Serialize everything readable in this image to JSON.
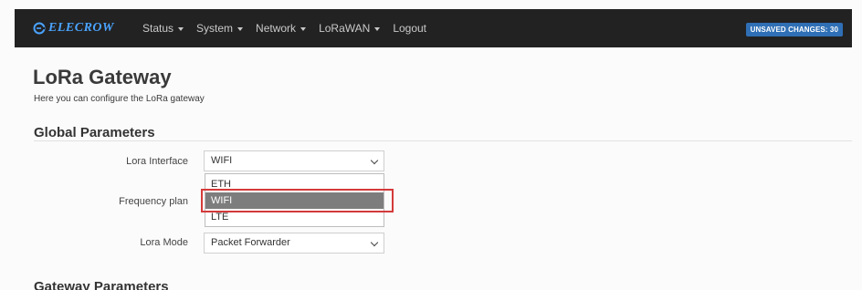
{
  "navbar": {
    "brand": "ELECROW",
    "menu": [
      {
        "label": "Status",
        "has_caret": true
      },
      {
        "label": "System",
        "has_caret": true
      },
      {
        "label": "Network",
        "has_caret": true
      },
      {
        "label": "LoRaWAN",
        "has_caret": true
      },
      {
        "label": "Logout",
        "has_caret": false
      }
    ],
    "unsaved_badge": "UNSAVED CHANGES: 30"
  },
  "page": {
    "title": "LoRa Gateway",
    "description": "Here you can configure the LoRa gateway"
  },
  "global_parameters": {
    "title": "Global Parameters",
    "lora_interface": {
      "label": "Lora Interface",
      "value": "WIFI",
      "options": [
        "ETH",
        "WIFI",
        "LTE"
      ],
      "highlighted_option": "WIFI"
    },
    "frequency_plan": {
      "label": "Frequency plan"
    },
    "lora_mode": {
      "label": "Lora Mode",
      "value": "Packet Forwarder"
    }
  },
  "gateway_parameters": {
    "title": "Gateway Parameters"
  },
  "colors": {
    "navbar_bg": "#222222",
    "brand": "#4aa3ff",
    "badge_bg": "#2f6fb5",
    "selected_option_bg": "#7d7d7d",
    "highlight_border": "#d43a3a"
  },
  "icons": {
    "brand_logo": "elecrow-logo-icon",
    "menu_caret": "caret-down-icon",
    "select_chevron": "chevron-down-icon"
  }
}
